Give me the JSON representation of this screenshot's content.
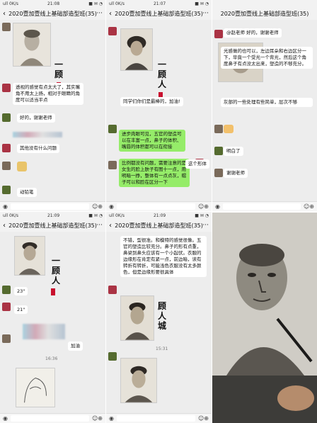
{
  "panels": [
    {
      "status_left": "ull 0K/s",
      "status_time": "21:08",
      "status_right": "■ ✉ ◔",
      "title": "2020壹加壹线上基础部造型班(35)",
      "texts": [
        {
          "t": "透视的感觉有点太大了，其实嘴角不用太上扬，相对于眼睛的角度可以适当平点"
        },
        {
          "t": "好的，谢谢老师"
        },
        {
          "t": "其他没有什么问题"
        },
        {
          "t": "动铅笔"
        }
      ],
      "vtitle": "一顾"
    },
    {
      "status_left": "ull 0K/s",
      "status_time": "21:07",
      "status_right": "■ ✉ ◔",
      "title": "2020壹加壹线上基础部造型班(35)",
      "texts": [
        {
          "t": "同学们你们是最棒的，加油!"
        },
        {
          "t": "进步肉眼可见，五官的塑造可以在丰富一点，鼻子的体积、嘴唇的体积都可以在衔接"
        },
        {
          "t": "比例都没有问题，需要注意的是女生的脸上肤子有图十一点，用明暗一挣，整体有一点点灰，帽子可以和脸在区分一下"
        },
        {
          "t": "这个形体"
        }
      ],
      "vtitle": "一顾人"
    },
    {
      "status_left": "",
      "status_time": "",
      "status_right": "",
      "title": "2020壹加壹线上基础部造型班(35)",
      "texts": [
        {
          "t": "@赵老师 好的，谢谢老师"
        },
        {
          "t": "光感做的也可以，左边耳朵和右边区分一下，毕竟一个受光一个背光，然后这个角度鼻子有点没太出来，塑造的不够充分。"
        },
        {
          "t": "灰部的一些处理有些简单，层次不够"
        },
        {
          "t": "明白了"
        },
        {
          "t": "谢谢老师"
        }
      ]
    },
    {
      "status_left": "ull 0K/s",
      "status_time": "21:09",
      "status_right": "■ ✉ ◔",
      "title": "2020壹加壹线上基础部造型班(35)",
      "texts": [
        {
          "t": "23\""
        },
        {
          "t": "21\""
        },
        {
          "t": "加油"
        },
        {
          "t": "16:36"
        }
      ],
      "vtitle": "一顾人"
    },
    {
      "status_left": "ull 0K/s",
      "status_time": "21:09",
      "status_right": "■ ✉ ◔",
      "title": "2020壹加壹线上基础部造型班(35)",
      "texts": [
        {
          "t": "不错，型很准。和模特的感觉很像。五官的塑造比较充分。鼻子的形有点重，鼻梁到鼻头应该有一个小起伏。衣服的边缘形在肯定有紧一点，前边暗，读有转折有转折，可能浅色衣服没有太多颜色，但是边缘形要很具体"
        },
        {
          "t": "顾人城"
        },
        {
          "t": "15:31"
        }
      ]
    }
  ],
  "icons": {
    "voice": "voice-icon",
    "emoji": "emoji-icon",
    "plus": "plus-icon",
    "back": "back-icon",
    "more": "more-icon"
  }
}
